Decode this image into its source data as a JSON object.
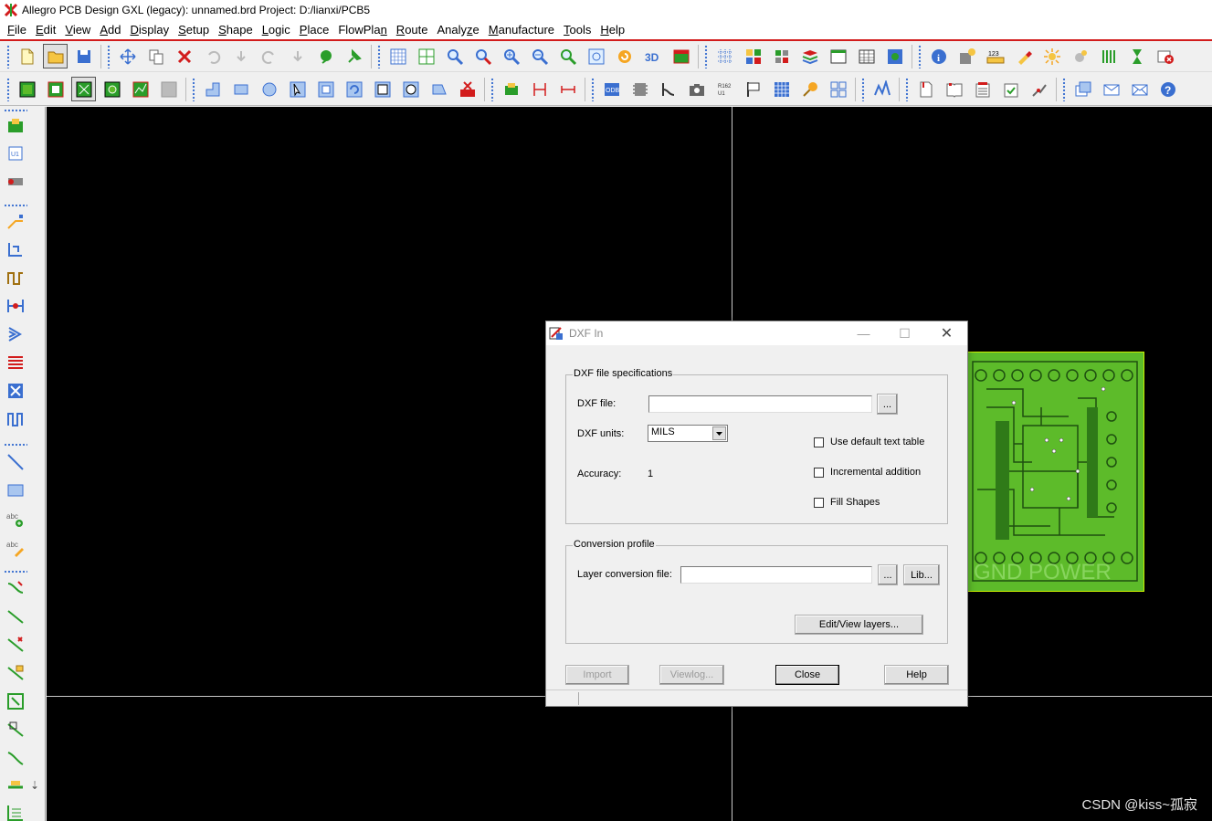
{
  "window": {
    "title": "Allegro PCB Design GXL (legacy): unnamed.brd  Project: D:/lianxi/PCB5"
  },
  "menu": [
    {
      "label": "File",
      "u": "F",
      "rest": "ile"
    },
    {
      "label": "Edit",
      "u": "E",
      "rest": "dit"
    },
    {
      "label": "View",
      "u": "V",
      "rest": "iew"
    },
    {
      "label": "Add",
      "u": "A",
      "rest": "dd"
    },
    {
      "label": "Display",
      "u": "D",
      "rest": "isplay"
    },
    {
      "label": "Setup",
      "u": "S",
      "rest": "etup"
    },
    {
      "label": "Shape",
      "u": "S",
      "rest": "hape"
    },
    {
      "label": "Logic",
      "u": "L",
      "rest": "ogic"
    },
    {
      "label": "Place",
      "u": "P",
      "rest": "lace"
    },
    {
      "label": "FlowPlan",
      "pre": "FlowPla",
      "u": "n",
      "rest": ""
    },
    {
      "label": "Route",
      "u": "R",
      "rest": "oute"
    },
    {
      "label": "Analyze",
      "pre": "Analy",
      "u": "z",
      "rest": "e"
    },
    {
      "label": "Manufacture",
      "u": "M",
      "rest": "anufacture"
    },
    {
      "label": "Tools",
      "u": "T",
      "rest": "ools"
    },
    {
      "label": "Help",
      "u": "H",
      "rest": "elp"
    }
  ],
  "colors": {
    "accent_red": "#d21c1c",
    "canvas_bg": "#000000",
    "pcb_green": "#5dbb2a",
    "pcb_outline": "#c8f000"
  },
  "board": {
    "silkscreen_text": "GND  POWER"
  },
  "dialog": {
    "title": "DXF In",
    "min_glyph": "—",
    "max_glyph": "☐",
    "close_glyph": "✕",
    "spec_group": {
      "legend": "DXF file specifications",
      "dxf_file_label": "DXF file:",
      "dxf_file_value": "",
      "browse_label": "...",
      "units_label": "DXF units:",
      "units_value": "MILS",
      "accuracy_label": "Accuracy:",
      "accuracy_value": "1",
      "checkboxes": [
        {
          "label": "Use default text table",
          "checked": false
        },
        {
          "label": "Incremental addition",
          "checked": false
        },
        {
          "label": "Fill Shapes",
          "checked": false
        }
      ]
    },
    "profile_group": {
      "legend": "Conversion profile",
      "layer_file_label": "Layer conversion file:",
      "layer_file_value": "",
      "browse_label": "...",
      "lib_label": "Lib...",
      "edit_layers_label": "Edit/View layers..."
    },
    "buttons": {
      "import": "Import",
      "viewlog": "Viewlog...",
      "close": "Close",
      "help": "Help"
    }
  },
  "watermark": "CSDN @kiss~孤寂"
}
